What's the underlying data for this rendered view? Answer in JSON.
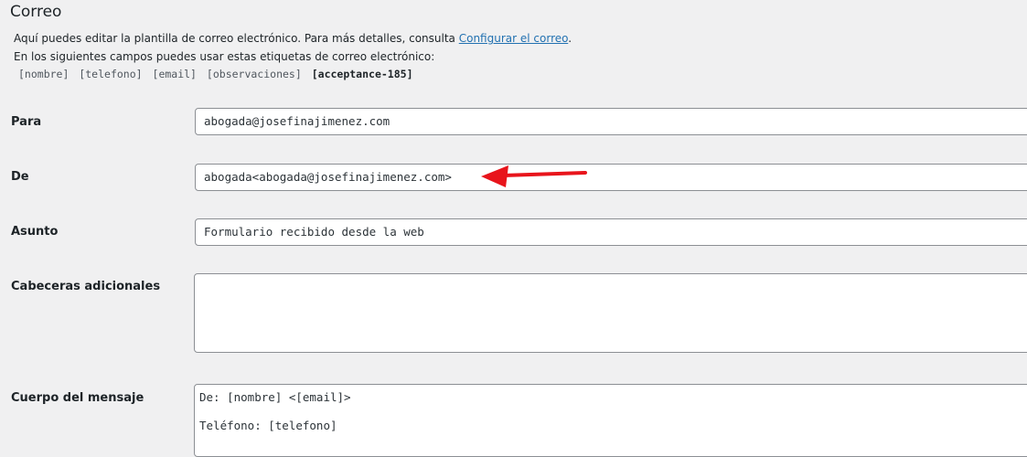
{
  "section": {
    "title": "Correo"
  },
  "description": {
    "line1_text": "Aquí puedes editar la plantilla de correo electrónico. Para más detalles, consulta ",
    "line1_link": "Configurar el correo",
    "line1_end": ".",
    "line2_text": "En los siguientes campos puedes usar estas etiquetas de correo electrónico:"
  },
  "tags": [
    {
      "label": "[nombre]",
      "bold": false
    },
    {
      "label": "[telefono]",
      "bold": false
    },
    {
      "label": "[email]",
      "bold": false
    },
    {
      "label": "[observaciones]",
      "bold": false
    },
    {
      "label": "[acceptance-185]",
      "bold": true
    }
  ],
  "fields": {
    "para": {
      "label": "Para",
      "value": "abogada@josefinajimenez.com"
    },
    "de": {
      "label": "De",
      "value": "abogada<abogada@josefinajimenez.com>"
    },
    "asunto": {
      "label": "Asunto",
      "value": "Formulario recibido desde la web"
    },
    "cabeceras": {
      "label": "Cabeceras adicionales",
      "value": ""
    },
    "cuerpo": {
      "label": "Cuerpo del mensaje",
      "line1": "De: [nombre] <[email]>",
      "line2": "",
      "line3": "Teléfono: [telefono]"
    }
  },
  "annotation": {
    "arrow_color": "#e8141b"
  },
  "colors": {
    "background": "#f0f0f1",
    "link": "#2271b1",
    "input_border": "#8c8f94"
  }
}
